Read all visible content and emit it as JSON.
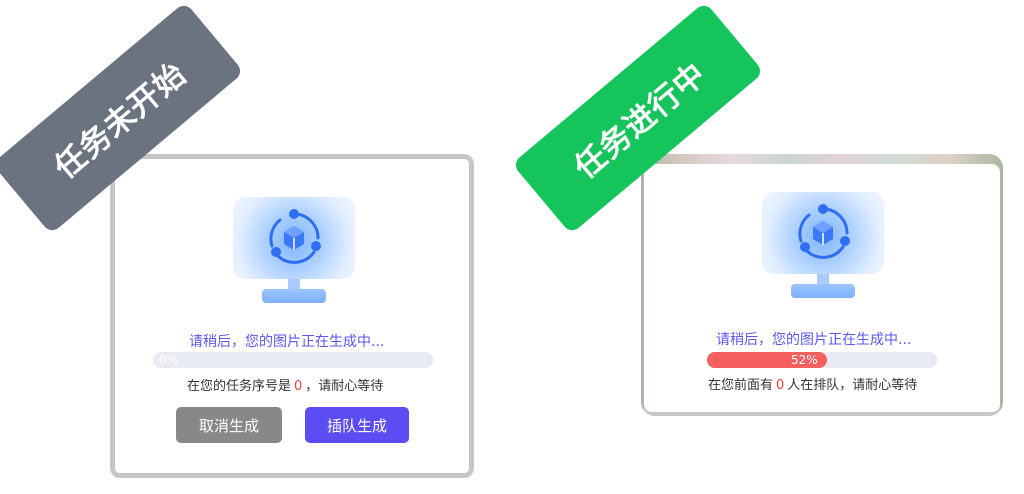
{
  "ribbons": {
    "not_started": "任务未开始",
    "in_progress": "任务进行中"
  },
  "left_card": {
    "status": "请稍后，您的图片正在生成中...",
    "progress": {
      "percent": 0,
      "label": "0%"
    },
    "queue_prefix": "在您的任务序号是",
    "queue_number": "0",
    "queue_suffix": "，请耐心等待",
    "cancel_label": "取消生成",
    "jump_label": "插队生成"
  },
  "right_card": {
    "status": "请稍后，您的图片正在生成中...",
    "progress": {
      "percent": 52,
      "label": "52%"
    },
    "queue_prefix": "在您前面有",
    "queue_number": "0",
    "queue_suffix": "人在排队，请耐心等待"
  },
  "colors": {
    "ribbon_gray": "#6b7280",
    "ribbon_green": "#16c45c",
    "accent_purple": "#5b4df3",
    "progress_red": "#f25f5c",
    "highlight_red": "#f03e3e"
  },
  "icons": {
    "illustration": "monitor-ai-icon"
  }
}
